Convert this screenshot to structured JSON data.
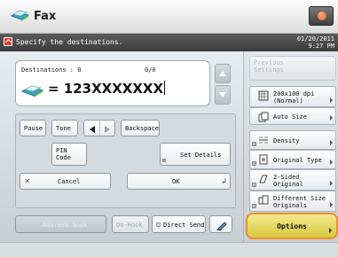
{
  "header": {
    "title": "Fax"
  },
  "status": {
    "message": "Specify the destinations.",
    "date": "01/20/2011",
    "time": "9:27 PM"
  },
  "destination": {
    "label": "Destinations : 0",
    "counter": "0/0",
    "value": "= 123XXXXXXX"
  },
  "keypad": {
    "pause": "Pause",
    "tone": "Tone",
    "backspace": "Backspace",
    "pin_code_line1": "PIN",
    "pin_code_line2": "Code",
    "set_details": "Set Details",
    "cancel": "Cancel",
    "ok": "OK"
  },
  "bottom_bar": {
    "address_book": "Address Book",
    "on_hook": "On-Hook",
    "direct_send": "Direct Send"
  },
  "right_panel": {
    "previous_settings_line1": "Previous",
    "previous_settings_line2": "Settings",
    "settings": [
      {
        "line1": "200x100 dpi",
        "line2": "(Normal)",
        "icon": "resolution-icon"
      },
      {
        "line1": "Auto Size",
        "line2": "",
        "icon": "size-icon"
      },
      {
        "line1": "Density",
        "line2": "",
        "icon": "density-icon"
      },
      {
        "line1": "Original Type",
        "line2": "",
        "icon": "original-type-icon"
      },
      {
        "line1": "2-Sided",
        "line2": "Original",
        "icon": "two-sided-icon"
      },
      {
        "line1": "Different Size",
        "line2": "Originals",
        "icon": "different-size-icon"
      }
    ],
    "options": "Options"
  },
  "colors": {
    "accent": "#f08e2a",
    "status_bg": "#4a4a4a",
    "warning": "#e23b2b",
    "options_fill": "#e4d458"
  }
}
